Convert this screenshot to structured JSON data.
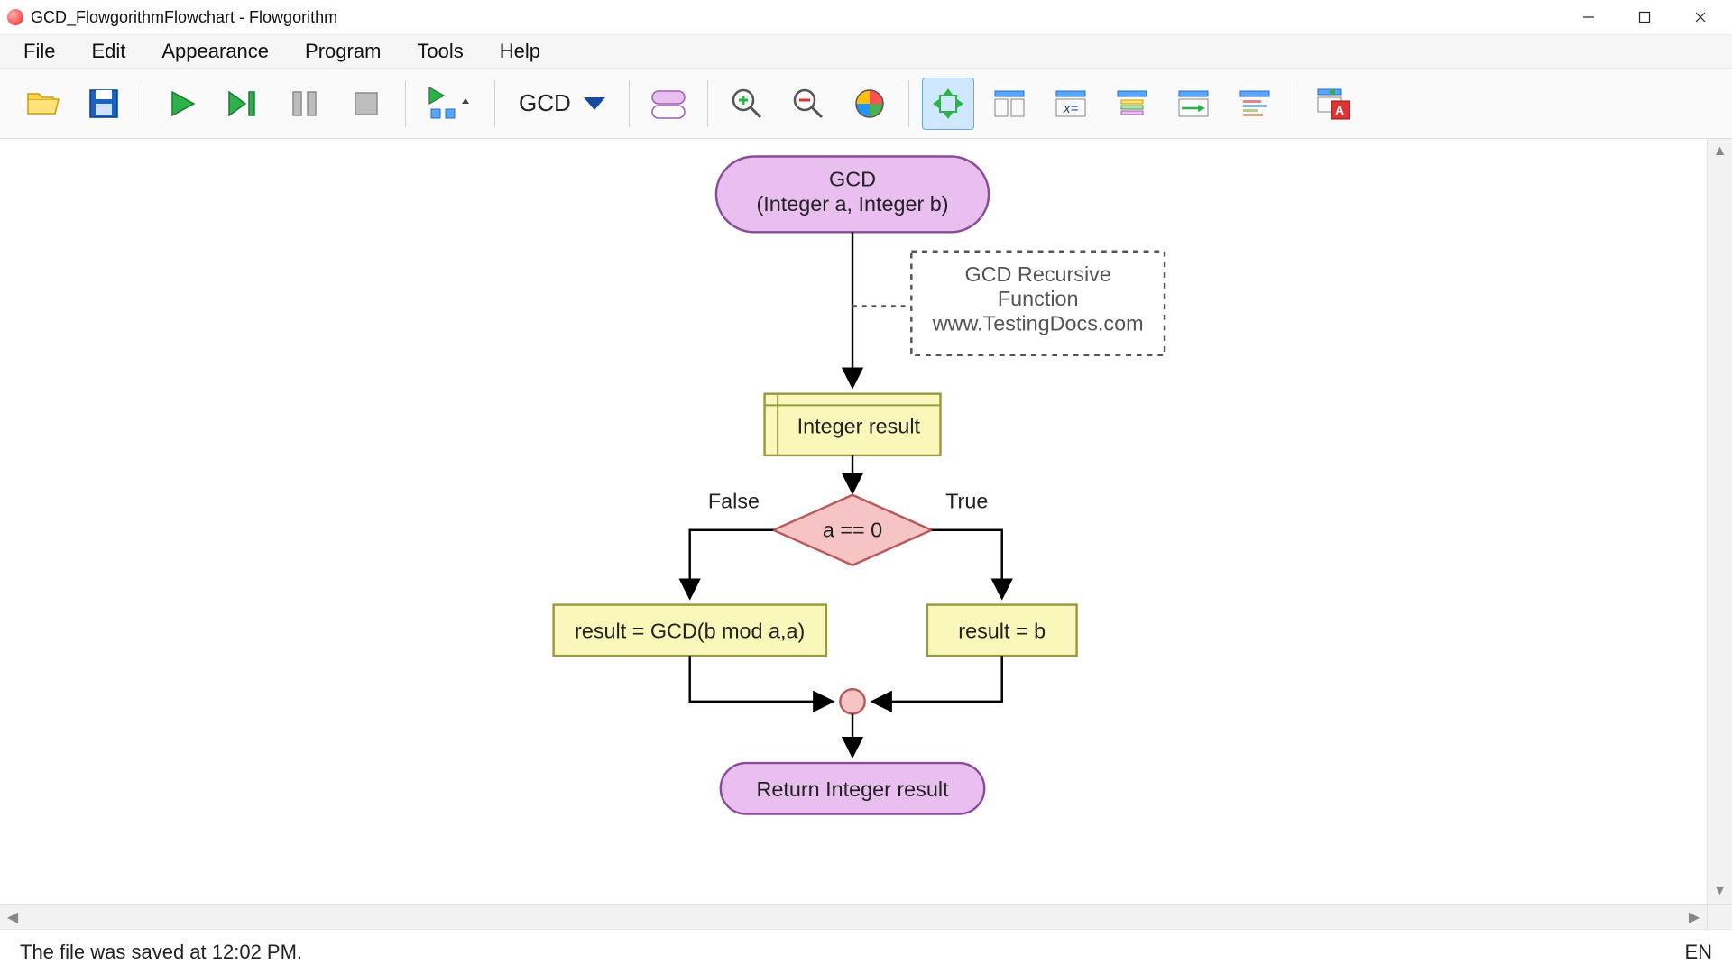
{
  "window": {
    "title": "GCD_FlowgorithmFlowchart - Flowgorithm"
  },
  "menu": {
    "items": [
      "File",
      "Edit",
      "Appearance",
      "Program",
      "Tools",
      "Help"
    ]
  },
  "toolbar": {
    "function_selected": "GCD",
    "fit_active": true
  },
  "flowchart": {
    "start_name": "GCD",
    "start_params": "(Integer a, Integer b)",
    "comment_line1": "GCD Recursive",
    "comment_line2": "Function",
    "comment_line3": "www.TestingDocs.com",
    "declare": "Integer result",
    "decision": "a == 0",
    "label_false": "False",
    "label_true": "True",
    "assign_false": "result = GCD(b mod a,a)",
    "assign_true": "result = b",
    "return": "Return Integer result"
  },
  "status": {
    "message": "The file was saved at 12:02 PM.",
    "lang": "EN"
  }
}
